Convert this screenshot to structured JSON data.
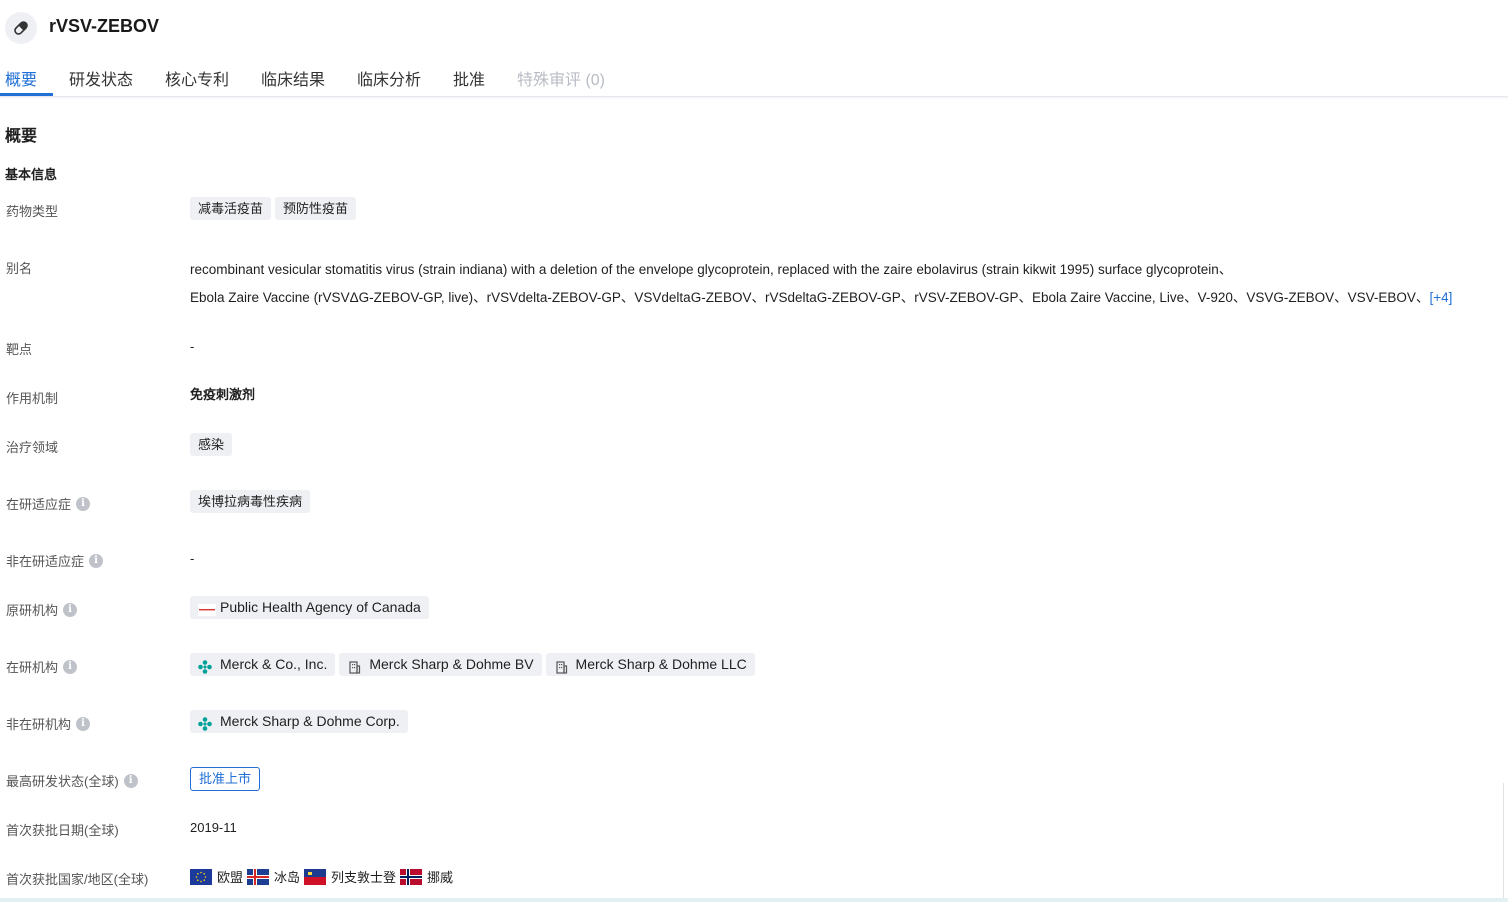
{
  "drug": {
    "name": "rVSV-ZEBOV",
    "icon": "pill-icon"
  },
  "tabs": [
    {
      "label": "概要",
      "state": "active"
    },
    {
      "label": "研发状态",
      "state": "normal"
    },
    {
      "label": "核心专利",
      "state": "normal"
    },
    {
      "label": "临床结果",
      "state": "normal"
    },
    {
      "label": "临床分析",
      "state": "normal"
    },
    {
      "label": "批准",
      "state": "normal"
    },
    {
      "label": "特殊审评 (0)",
      "state": "disabled"
    }
  ],
  "section": {
    "title": "概要",
    "subtitle": "基本信息"
  },
  "fields": {
    "drug_type": {
      "label": "药物类型",
      "tags": [
        "减毒活疫苗",
        "预防性疫苗"
      ]
    },
    "alias": {
      "label": "别名",
      "line1": "recombinant vesicular stomatitis virus (strain indiana) with a deletion of the envelope glycoprotein, replaced with the zaire ebolavirus (strain kikwit 1995) surface glycoprotein、",
      "line2": "Ebola Zaire Vaccine (rVSVΔG-ZEBOV-GP, live)、rVSVdelta-ZEBOV-GP、VSVdeltaG-ZEBOV、rVSdeltaG-ZEBOV-GP、rVSV-ZEBOV-GP、Ebola Zaire Vaccine, Live、V-920、VSVG-ZEBOV、VSV-EBOV、",
      "more": "[+4]"
    },
    "target": {
      "label": "靶点",
      "value": "-"
    },
    "mechanism": {
      "label": "作用机制",
      "value": "免疫刺激剂"
    },
    "therapeutic_area": {
      "label": "治疗领域",
      "tags": [
        "感染"
      ]
    },
    "active_indication": {
      "label": "在研适应症",
      "tags": [
        "埃博拉病毒性疾病"
      ]
    },
    "inactive_indication": {
      "label": "非在研适应症",
      "value": "-"
    },
    "originator": {
      "label": "原研机构",
      "orgs": [
        {
          "name": "Public Health Agency of Canada",
          "icon": "agency-logo-icon"
        }
      ]
    },
    "active_org": {
      "label": "在研机构",
      "orgs": [
        {
          "name": "Merck & Co., Inc.",
          "icon": "merck-logo-icon"
        },
        {
          "name": "Merck Sharp & Dohme BV",
          "icon": "building-icon"
        },
        {
          "name": "Merck Sharp & Dohme LLC",
          "icon": "building-icon"
        }
      ]
    },
    "inactive_org": {
      "label": "非在研机构",
      "orgs": [
        {
          "name": "Merck Sharp & Dohme Corp.",
          "icon": "merck-logo-icon"
        }
      ]
    },
    "highest_status": {
      "label": "最高研发状态(全球)",
      "value": "批准上市"
    },
    "first_approval_date": {
      "label": "首次获批日期(全球)",
      "value": "2019-11"
    },
    "first_approval_region": {
      "label": "首次获批国家/地区(全球)",
      "countries": [
        {
          "name": "欧盟",
          "flag": "eu-flag-icon"
        },
        {
          "name": "冰岛",
          "flag": "iceland-flag-icon"
        },
        {
          "name": "列支敦士登",
          "flag": "liechtenstein-flag-icon"
        },
        {
          "name": "挪威",
          "flag": "norway-flag-icon"
        }
      ]
    }
  },
  "colors": {
    "accent": "#1f6fd6",
    "tag_bg": "#eef0f3",
    "merck_green": "#00a19a"
  }
}
